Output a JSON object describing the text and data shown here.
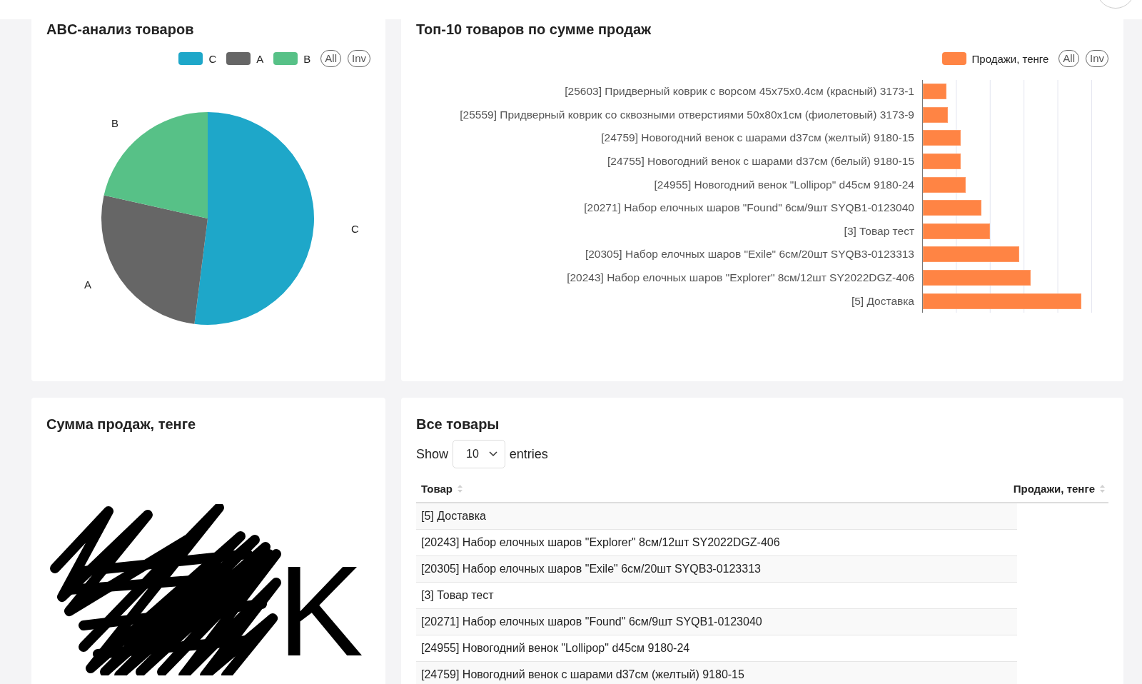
{
  "abc_card": {
    "title": "ABC-анализ товаров",
    "legend": [
      {
        "label": "C",
        "color": "#1ea7c9"
      },
      {
        "label": "A",
        "color": "#666666"
      },
      {
        "label": "B",
        "color": "#57c187"
      }
    ],
    "legend_buttons": [
      "All",
      "Inv"
    ],
    "slice_labels": [
      "B",
      "C",
      "A"
    ]
  },
  "top10_card": {
    "title": "Топ-10 товаров по сумме продаж",
    "legend": [
      {
        "label": "Продажи, тенге",
        "color": "#ff8444"
      }
    ],
    "legend_buttons": [
      "All",
      "Inv"
    ],
    "bar_labels": [
      "[25603] Придверный коврик с ворсом 45x75x0.4см (красный) 3173-1",
      "[25559] Придверный коврик со сквозными отверстиями 50x80x1см (фиолетовый) 3173-9",
      "[24759] Новогодний венок с шарами d37см (желтый) 9180-15",
      "[24755] Новогодний венок с шарами d37см (белый) 9180-15",
      "[24955] Новогодний венок \"Lollipop\" d45см 9180-24",
      "[20271] Набор елочных шаров \"Found\" 6см/9шт SYQB1-0123040",
      "[3] Товар тест",
      "[20305] Набор елочных шаров \"Exile\" 6см/20шт SYQB3-0123313",
      "[20243] Набор елочных шаров \"Explorer\" 8см/12шт SY2022DGZ-406",
      "[5] Доставка"
    ]
  },
  "sales_card": {
    "title": "Сумма продаж, тенге",
    "value_suffix": "K"
  },
  "products_card": {
    "title": "Все товары",
    "show_label": "Show",
    "page_size": "10",
    "entries_label": "entries",
    "columns": [
      "Товар",
      "Продажи, тенге"
    ],
    "rows": [
      {
        "product": "[5] Доставка"
      },
      {
        "product": "[20243] Набор елочных шаров \"Explorer\" 8см/12шт SY2022DGZ-406"
      },
      {
        "product": "[20305] Набор елочных шаров \"Exile\" 6см/20шт SYQB3-0123313"
      },
      {
        "product": "[3] Товар тест"
      },
      {
        "product": "[20271] Набор елочных шаров \"Found\" 6см/9шт SYQB1-0123040"
      },
      {
        "product": "[24955] Новогодний венок \"Lollipop\" d45см 9180-24"
      },
      {
        "product": "[24759] Новогодний венок с шарами d37см (желтый) 9180-15"
      }
    ]
  }
}
